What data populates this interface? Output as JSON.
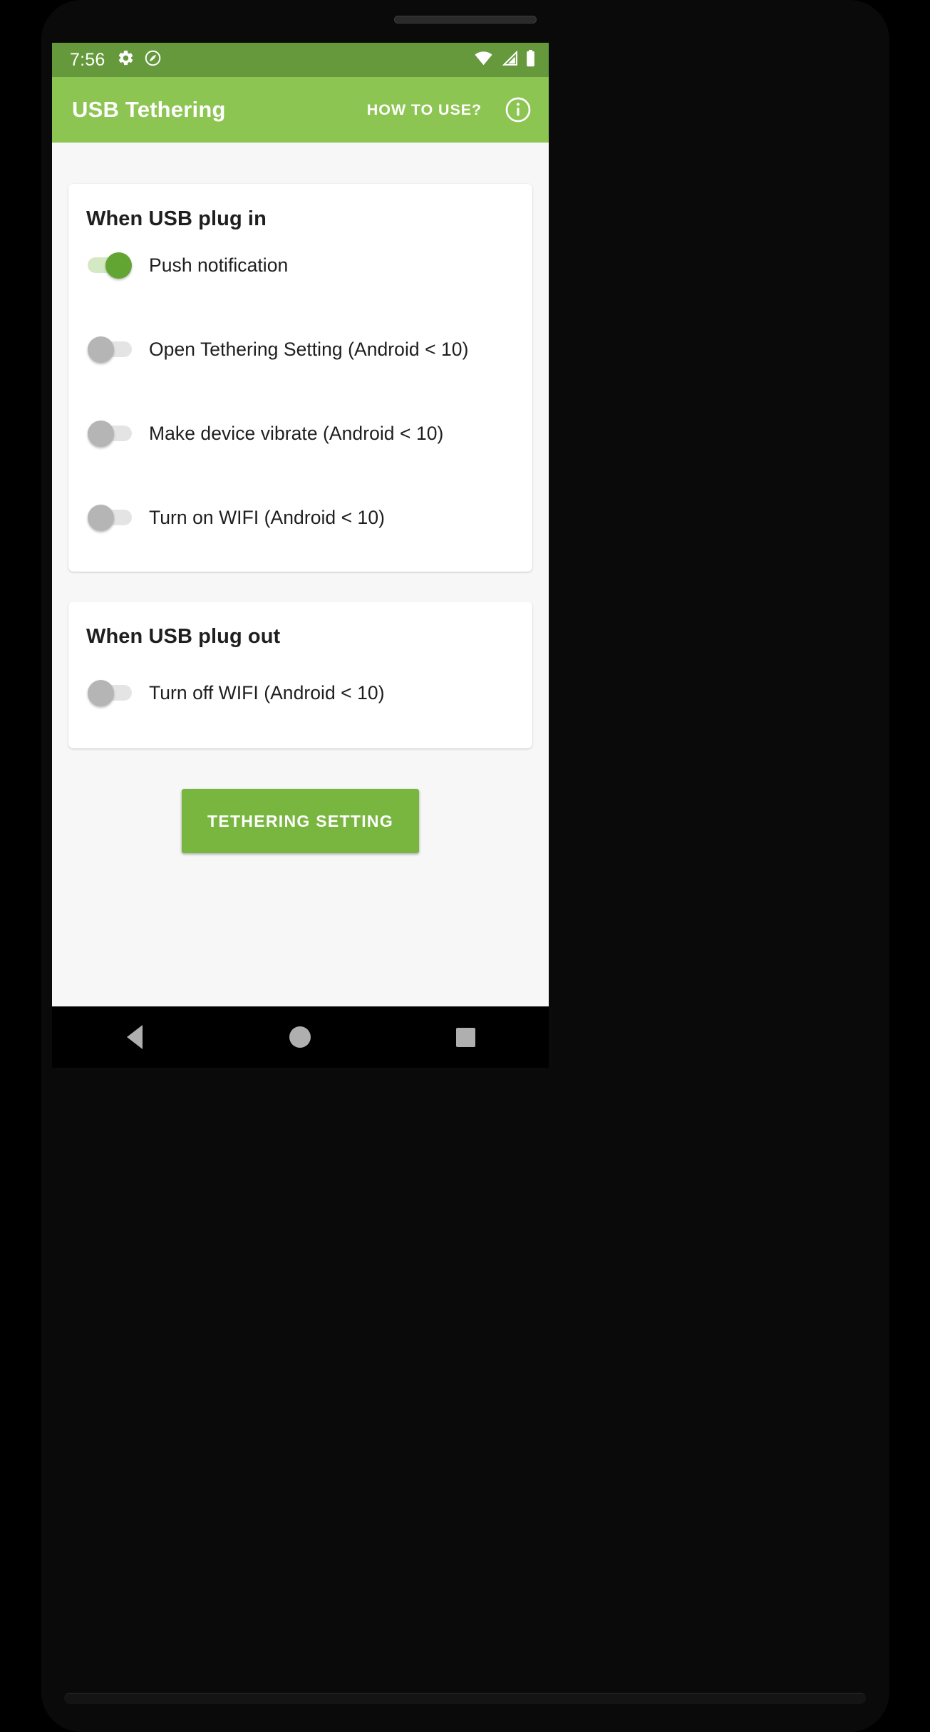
{
  "status_bar": {
    "time": "7:56",
    "left_icons": [
      "gear-icon",
      "compass-icon"
    ],
    "right_icons": [
      "wifi-icon",
      "cell-signal-icon",
      "battery-icon"
    ],
    "background_color": "#65993C"
  },
  "app_bar": {
    "title": "USB Tethering",
    "how_to_use_label": "HOW TO USE?",
    "info_icon": "info-circle-icon",
    "background_color": "#8CC552"
  },
  "cards": [
    {
      "id": "plug-in",
      "title": "When USB plug in",
      "rows": [
        {
          "label": "Push notification",
          "state": "on"
        },
        {
          "label": "Open Tethering Setting (Android < 10)",
          "state": "off"
        },
        {
          "label": "Make device vibrate (Android < 10)",
          "state": "off"
        },
        {
          "label": "Turn on WIFI (Android < 10)",
          "state": "off"
        }
      ]
    },
    {
      "id": "plug-out",
      "title": "When USB plug out",
      "rows": [
        {
          "label": "Turn off WIFI (Android < 10)",
          "state": "off"
        }
      ]
    }
  ],
  "primary_button": {
    "label": "TETHERING SETTING",
    "color": "#79B640"
  },
  "nav_bar": {
    "back_label": "Back",
    "home_label": "Home",
    "recents_label": "Recents"
  },
  "theme": {
    "accent": "#8CC552",
    "accent_dark": "#65993C",
    "switch_on_thumb": "#63A532",
    "switch_on_track": "#D5E8C4",
    "switch_off_thumb": "#B5B5B5",
    "switch_off_track": "#E4E4E4",
    "page_background": "#F7F7F7",
    "card_background": "#FFFFFF"
  }
}
